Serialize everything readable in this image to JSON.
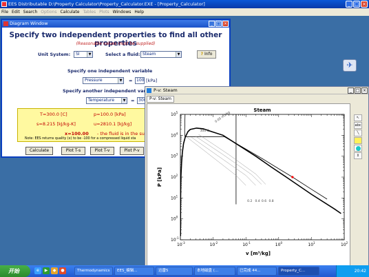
{
  "app": {
    "title": "EES Distributable  D:\\Property Calculator\\Property_Calculator.EXE - [Property_Calculator]",
    "menu": [
      {
        "label": "File",
        "enabled": true
      },
      {
        "label": "Edit",
        "enabled": true
      },
      {
        "label": "Search",
        "enabled": true
      },
      {
        "label": "Options",
        "enabled": false
      },
      {
        "label": "Calculate",
        "enabled": true
      },
      {
        "label": "Tables",
        "enabled": false
      },
      {
        "label": "Plots",
        "enabled": false
      },
      {
        "label": "Windows",
        "enabled": true
      },
      {
        "label": "Help",
        "enabled": true
      }
    ]
  },
  "diagram": {
    "title": "Diagram Window",
    "heading": "Specify two independent properties to find all other properties",
    "subheading": "(Reasonable values must be supplied)",
    "unit_system_label": "Unit System:",
    "unit_system_value": "SI",
    "fluid_label": "Select a fluid:",
    "fluid_value": "Steam",
    "info_button": "Info",
    "var1_label": "Specify one independent variable",
    "var1_name": "Pressure",
    "var1_value": "100",
    "var1_unit": "[kPa]",
    "var2_label": "Specify another independent var",
    "var2_name": "Temperature",
    "var2_value": "300",
    "equals": "=",
    "results": {
      "T": "T=300.0  [C]",
      "P": "p=100.0  [kPa]",
      "s": "s=8.215  [kJ/kg-K]",
      "u": "u=2810.1  [kJ/kg]",
      "v_cut": "v",
      "x": "x=100.00",
      "x_note": "-  the fluid is in the superheat",
      "note": "Note:  EES returns quality (x) to be -100 for a compressed liquid sta"
    },
    "buttons": {
      "calculate": "Calculate",
      "plot_ts": "Plot T-s",
      "plot_tv": "Plot T-v",
      "plot_pv": "Plot P-v"
    }
  },
  "pv_window": {
    "title": "P-v: Steam",
    "tab": "P-v: Steam"
  },
  "chart_data": {
    "type": "line",
    "title": "Steam",
    "xlabel": "v [m3/kg]",
    "ylabel": "P [kPa]",
    "x_scale": "log",
    "y_scale": "log",
    "xlim": [
      0.001,
      100
    ],
    "ylim": [
      0.1,
      100000
    ],
    "x_ticks": [
      "10-3",
      "10-2",
      "10-1",
      "100",
      "101",
      "102"
    ],
    "y_ticks": [
      "10-1",
      "100",
      "101",
      "102",
      "103",
      "104",
      "105"
    ],
    "annotations": [
      "300 C",
      "0.05 m3/kg",
      "0.2",
      "0.4",
      "0.6",
      "0.8"
    ],
    "series": [
      {
        "role": "saturation_dome",
        "color": "#000000",
        "points": [
          [
            0.00101,
            0.15
          ],
          [
            0.001015,
            1
          ],
          [
            0.00102,
            10
          ],
          [
            0.00104,
            100
          ],
          [
            0.00109,
            500
          ],
          [
            0.00115,
            1500
          ],
          [
            0.00125,
            4000
          ],
          [
            0.0014,
            8000
          ],
          [
            0.0017,
            15000
          ],
          [
            0.002,
            19000
          ],
          [
            0.00311,
            22064
          ],
          [
            0.005,
            20500
          ],
          [
            0.009,
            15000
          ],
          [
            0.02,
            10000
          ],
          [
            0.05,
            4000
          ],
          [
            0.2,
            1000
          ],
          [
            0.6,
            300
          ],
          [
            1.7,
            100
          ],
          [
            10,
            15
          ],
          [
            50,
            3
          ],
          [
            80,
            1.8
          ]
        ]
      },
      {
        "role": "isotherm_300C",
        "color": "#000000",
        "points": [
          [
            0.00139,
            100000
          ],
          [
            0.00137,
            40000
          ],
          [
            0.00135,
            15000
          ],
          [
            0.00138,
            8588
          ],
          [
            0.02167,
            8588
          ],
          [
            0.04,
            5000
          ],
          [
            0.1,
            2200
          ],
          [
            0.3,
            800
          ],
          [
            1,
            250
          ],
          [
            2.639,
            100
          ],
          [
            10,
            26
          ],
          [
            30,
            8.8
          ]
        ]
      },
      {
        "role": "isochore_0.05",
        "color": "#000000",
        "points": [
          [
            0.05,
            100000
          ],
          [
            0.05,
            100
          ],
          [
            0.05,
            5
          ]
        ]
      },
      {
        "role": "quality_0.2",
        "color": "#999999",
        "points": [
          [
            0.0016,
            8000
          ],
          [
            0.005,
            2000
          ],
          [
            0.05,
            120
          ],
          [
            0.1,
            40
          ]
        ]
      },
      {
        "role": "quality_0.4",
        "color": "#999999",
        "points": [
          [
            0.0022,
            8000
          ],
          [
            0.01,
            1500
          ],
          [
            0.1,
            120
          ],
          [
            0.2,
            40
          ]
        ]
      },
      {
        "role": "quality_0.6",
        "color": "#999999",
        "points": [
          [
            0.0029,
            9000
          ],
          [
            0.02,
            1200
          ],
          [
            0.15,
            130
          ],
          [
            0.3,
            45
          ]
        ]
      },
      {
        "role": "quality_0.8",
        "color": "#999999",
        "points": [
          [
            0.0036,
            11000
          ],
          [
            0.03,
            1200
          ],
          [
            0.2,
            140
          ],
          [
            0.4,
            45
          ]
        ]
      }
    ],
    "marker": {
      "v": 2.639,
      "P": 100,
      "color": "#ff0000"
    }
  },
  "taskbar": {
    "start": "开始",
    "items": [
      {
        "label": "Thermodynamics",
        "active": false
      },
      {
        "label": "EES_编辑...",
        "active": false
      },
      {
        "label": "迅雷5",
        "active": false
      },
      {
        "label": "本地磁盘 (...",
        "active": false
      },
      {
        "label": "已完成 44...",
        "active": false
      },
      {
        "label": "Property_C...",
        "active": true
      }
    ],
    "clock": "20:42"
  }
}
